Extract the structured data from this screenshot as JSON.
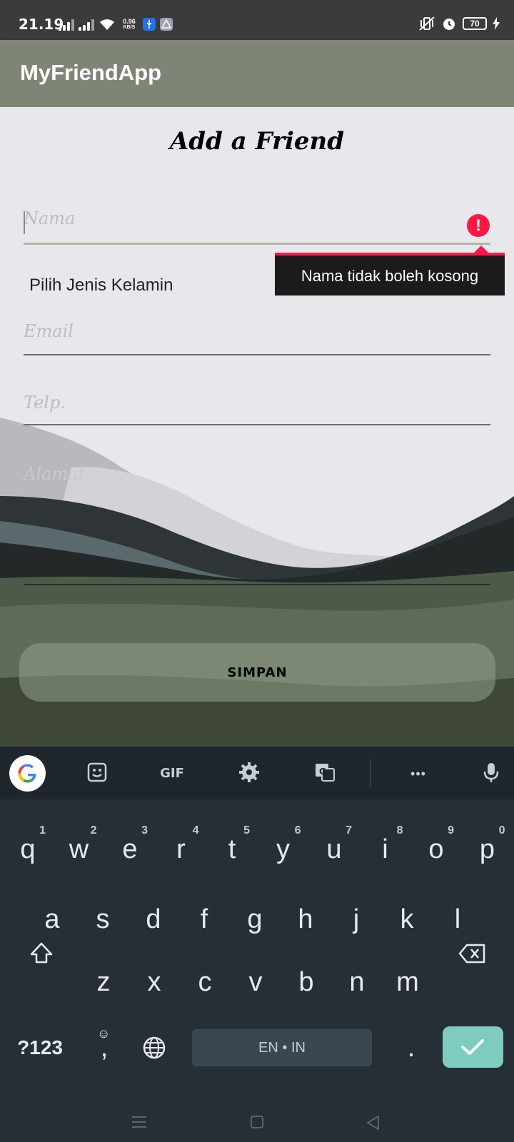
{
  "status_bar": {
    "time": "21.19",
    "net_speed_value": "0.96",
    "net_speed_unit": "KB/S",
    "battery_level": "70"
  },
  "app_bar": {
    "title": "MyFriendApp"
  },
  "form": {
    "heading": "Add a Friend",
    "name_placeholder": "Nama",
    "name_error": "Nama tidak boleh kosong",
    "gender_label": "Pilih Jenis Kelamin",
    "email_placeholder": "Email",
    "phone_placeholder": "Telp.",
    "address_placeholder": "Alamat",
    "save_label": "SIMPAN"
  },
  "keyboard": {
    "toolbar": [
      "google-logo",
      "sticker-icon",
      "GIF",
      "settings-icon",
      "translate-icon",
      "more-icon",
      "mic-icon"
    ],
    "gif_label": "GIF",
    "more_label": "•••",
    "row1": [
      {
        "key": "q",
        "hint": "1"
      },
      {
        "key": "w",
        "hint": "2"
      },
      {
        "key": "e",
        "hint": "3"
      },
      {
        "key": "r",
        "hint": "4"
      },
      {
        "key": "t",
        "hint": "5"
      },
      {
        "key": "y",
        "hint": "6"
      },
      {
        "key": "u",
        "hint": "7"
      },
      {
        "key": "i",
        "hint": "8"
      },
      {
        "key": "o",
        "hint": "9"
      },
      {
        "key": "p",
        "hint": "0"
      }
    ],
    "row2": [
      "a",
      "s",
      "d",
      "f",
      "g",
      "h",
      "j",
      "k",
      "l"
    ],
    "row3": [
      "z",
      "x",
      "c",
      "v",
      "b",
      "n",
      "m"
    ],
    "symbols_label": "?123",
    "comma_label": ",",
    "space_label": "EN • IN",
    "period_label": ".",
    "accent_color": "#7ecbc0"
  },
  "colors": {
    "app_bar": "#7e8577",
    "error": "#ff1744",
    "keyboard_bg": "#262f36"
  }
}
